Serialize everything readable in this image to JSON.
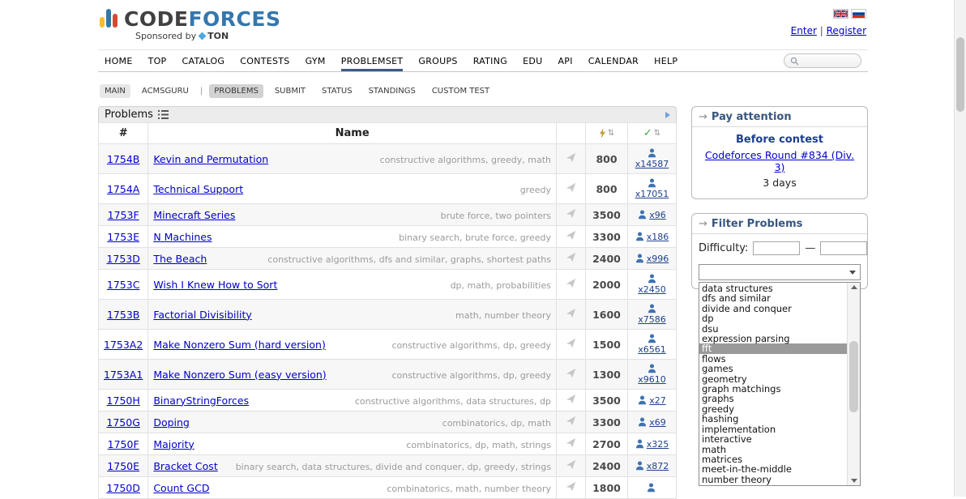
{
  "ui": {
    "pipe": "|",
    "dash": "—"
  },
  "icons": {
    "sort": "⇅",
    "check": "✓",
    "box_arrow": "→"
  },
  "header": {
    "logo_code": "CODE",
    "logo_forces": "FORCES",
    "sponsored_prefix": "Sponsored by",
    "sponsor": "TON",
    "enter": "Enter",
    "register": "Register"
  },
  "nav": {
    "items": [
      {
        "label": "HOME"
      },
      {
        "label": "TOP"
      },
      {
        "label": "CATALOG"
      },
      {
        "label": "CONTESTS"
      },
      {
        "label": "GYM"
      },
      {
        "label": "PROBLEMSET",
        "cls": "active"
      },
      {
        "label": "GROUPS"
      },
      {
        "label": "RATING"
      },
      {
        "label": "EDU"
      },
      {
        "label": "API"
      },
      {
        "label": "CALENDAR"
      },
      {
        "label": "HELP"
      }
    ]
  },
  "subnav": {
    "items": [
      {
        "label": "MAIN",
        "cls": "pill"
      },
      {
        "label": "ACMSGURU"
      },
      {
        "label": "|",
        "cls": "divider"
      },
      {
        "label": "PROBLEMS",
        "cls": "pill selected"
      },
      {
        "label": "SUBMIT"
      },
      {
        "label": "STATUS"
      },
      {
        "label": "STANDINGS"
      },
      {
        "label": "CUSTOM TEST"
      }
    ]
  },
  "problems": {
    "caption": "Problems",
    "col_id": "#",
    "col_name": "Name",
    "rows": [
      {
        "id": "1754B",
        "name": "Kevin and Permutation",
        "tags": "constructive algorithms, greedy, math",
        "rating": "800",
        "solved": "x14587"
      },
      {
        "id": "1754A",
        "name": "Technical Support",
        "tags": "greedy",
        "rating": "800",
        "solved": "x17051"
      },
      {
        "id": "1753F",
        "name": "Minecraft Series",
        "tags": "brute force, two pointers",
        "rating": "3500",
        "solved": "x96"
      },
      {
        "id": "1753E",
        "name": "N Machines",
        "tags": "binary search, brute force, greedy",
        "rating": "3300",
        "solved": "x186"
      },
      {
        "id": "1753D",
        "name": "The Beach",
        "tags": "constructive algorithms, dfs and similar, graphs, shortest paths",
        "rating": "2400",
        "solved": "x996"
      },
      {
        "id": "1753C",
        "name": "Wish I Knew How to Sort",
        "tags": "dp, math, probabilities",
        "rating": "2000",
        "solved": "x2450"
      },
      {
        "id": "1753B",
        "name": "Factorial Divisibility",
        "tags": "math, number theory",
        "rating": "1600",
        "solved": "x7586"
      },
      {
        "id": "1753A2",
        "name": "Make Nonzero Sum (hard version)",
        "tags": "constructive algorithms, dp, greedy",
        "rating": "1500",
        "solved": "x6561"
      },
      {
        "id": "1753A1",
        "name": "Make Nonzero Sum (easy version)",
        "tags": "constructive algorithms, dp, greedy",
        "rating": "1300",
        "solved": "x9610"
      },
      {
        "id": "1750H",
        "name": "BinaryStringForces",
        "tags": "constructive algorithms, data structures, dp",
        "rating": "3500",
        "solved": "x27"
      },
      {
        "id": "1750G",
        "name": "Doping",
        "tags": "combinatorics, dp, math",
        "rating": "3300",
        "solved": "x69"
      },
      {
        "id": "1750F",
        "name": "Majority",
        "tags": "combinatorics, dp, math, strings",
        "rating": "2700",
        "solved": "x325"
      },
      {
        "id": "1750E",
        "name": "Bracket Cost",
        "tags": "binary search, data structures, divide and conquer, dp, greedy, strings",
        "rating": "2400",
        "solved": "x872"
      },
      {
        "id": "1750D",
        "name": "Count GCD",
        "tags": "combinatorics, math, number theory",
        "rating": "1800",
        "solved": ""
      }
    ]
  },
  "sidebar": {
    "pay_attention": {
      "caption": "Pay attention",
      "before_contest": "Before contest",
      "contest_link": "Codeforces Round #834 (Div. 3)",
      "countdown": "3 days"
    },
    "filter": {
      "caption": "Filter Problems",
      "difficulty_label": "Difficulty:",
      "selected": "fft",
      "options": [
        "data structures",
        "dfs and similar",
        "divide and conquer",
        "dp",
        "dsu",
        "expression parsing",
        "fft",
        "flows",
        "games",
        "geometry",
        "graph matchings",
        "graphs",
        "greedy",
        "hashing",
        "implementation",
        "interactive",
        "math",
        "matrices",
        "meet-in-the-middle",
        "number theory"
      ]
    }
  },
  "colors": {
    "link_blue": "#0000CC",
    "logo_blue": "#3477AE",
    "bar_yellow": "#F6C026",
    "bar_blue": "#3179A9",
    "bar_red": "#D34A35",
    "option_highlight": "#9A9A9A"
  }
}
